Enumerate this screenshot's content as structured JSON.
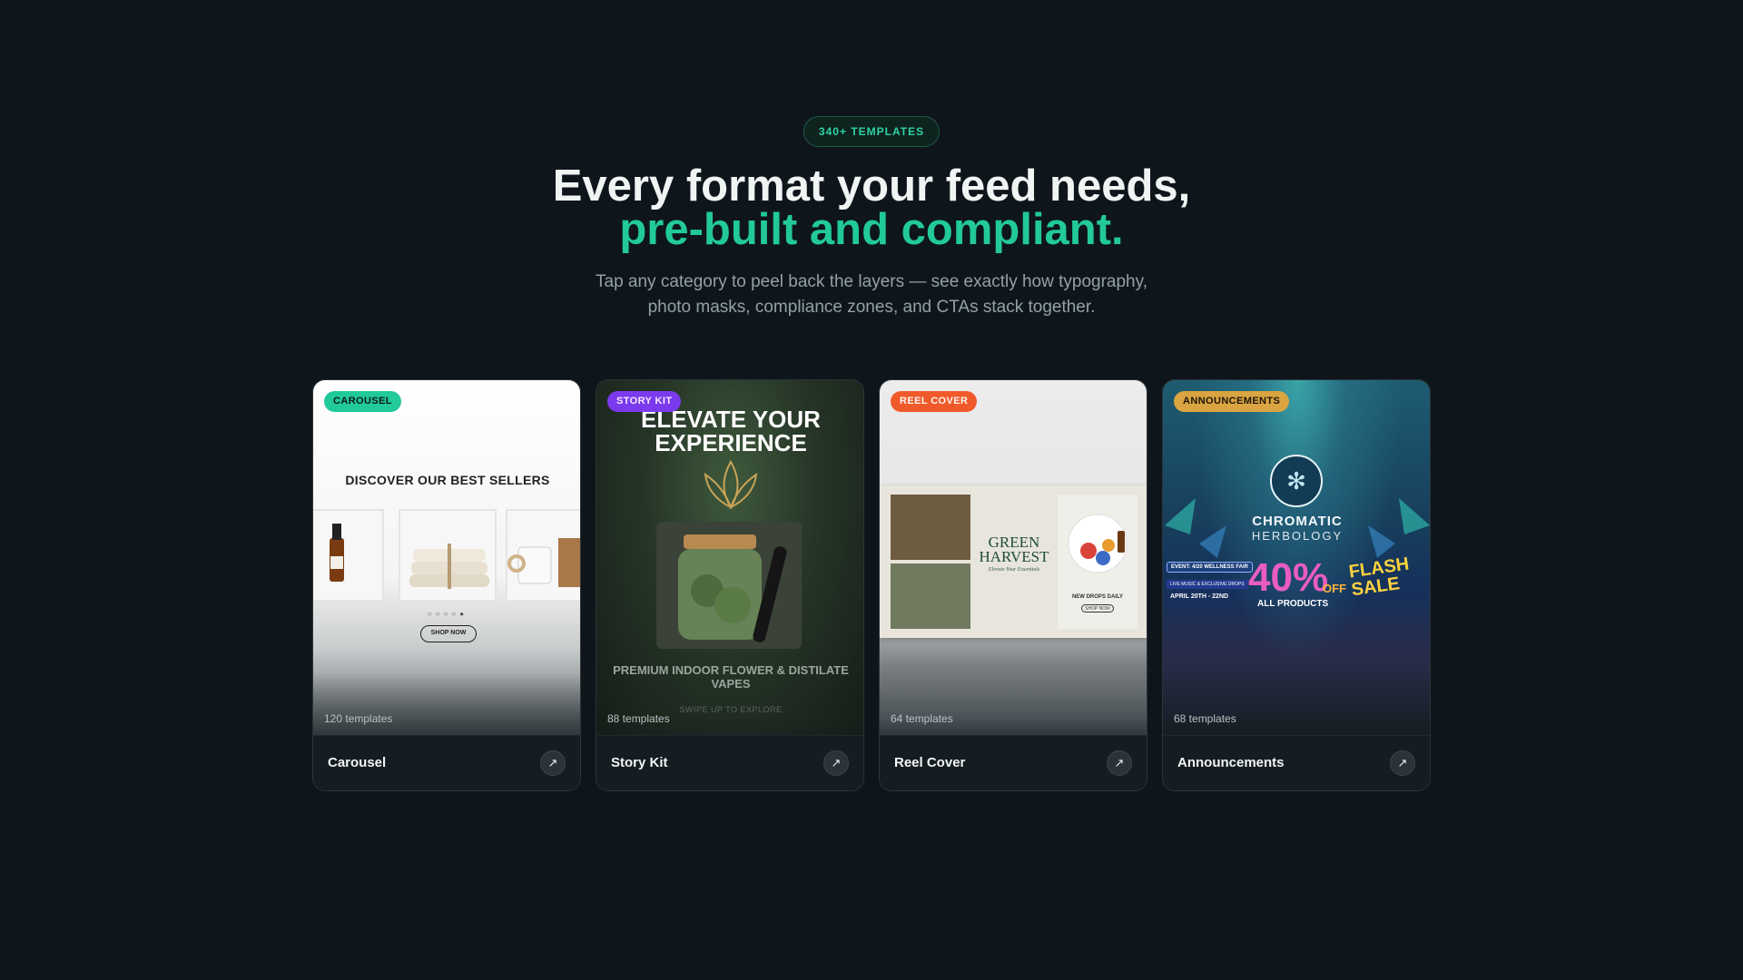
{
  "hero": {
    "badge": "340+ TEMPLATES",
    "title_line1": "Every format your feed needs,",
    "title_line2": "pre-built and compliant.",
    "subtitle": "Tap any category to peel back the layers — see exactly how typography, photo masks, compliance zones, and CTAs stack together."
  },
  "cards": [
    {
      "tag": "CAROUSEL",
      "tag_color": "#22c99a",
      "name": "Carousel",
      "count": "120 templates",
      "art": {
        "title": "DISCOVER OUR BEST SELLERS",
        "cta": "SHOP NOW"
      }
    },
    {
      "tag": "STORY KIT",
      "tag_color": "#7c3aed",
      "name": "Story Kit",
      "count": "88 templates",
      "art": {
        "title": "ELEVATE YOUR EXPERIENCE",
        "sub": "PREMIUM INDOOR FLOWER & DISTILATE VAPES",
        "swipe": "SWIPE UP TO EXPLORE"
      }
    },
    {
      "tag": "REEL COVER",
      "tag_color": "#f05a2b",
      "name": "Reel Cover",
      "count": "64 templates",
      "art": {
        "brand": "GREEN HARVEST",
        "tagline": "Elevate Your Essentials",
        "drops": "NEW DROPS DAILY",
        "cta": "SHOP NOW"
      }
    },
    {
      "tag": "ANNOUNCEMENTS",
      "tag_color": "#d9a441",
      "name": "Announcements",
      "count": "68 templates",
      "art": {
        "brand1": "CHROMATIC",
        "brand2": "HERBOLOGY",
        "event": "EVENT: 4/20 WELLNESS FAIR",
        "event_sub": "LIVE MUSIC & EXCLUSIVE DROPS",
        "dates": "APRIL 20TH - 22ND",
        "percent": "40%",
        "off": "OFF",
        "products": "ALL PRODUCTS",
        "flash": "FLASH SALE"
      }
    }
  ],
  "icons": {
    "open": "arrow-up-right-icon",
    "logo": "cannabis-leaf-icon"
  }
}
